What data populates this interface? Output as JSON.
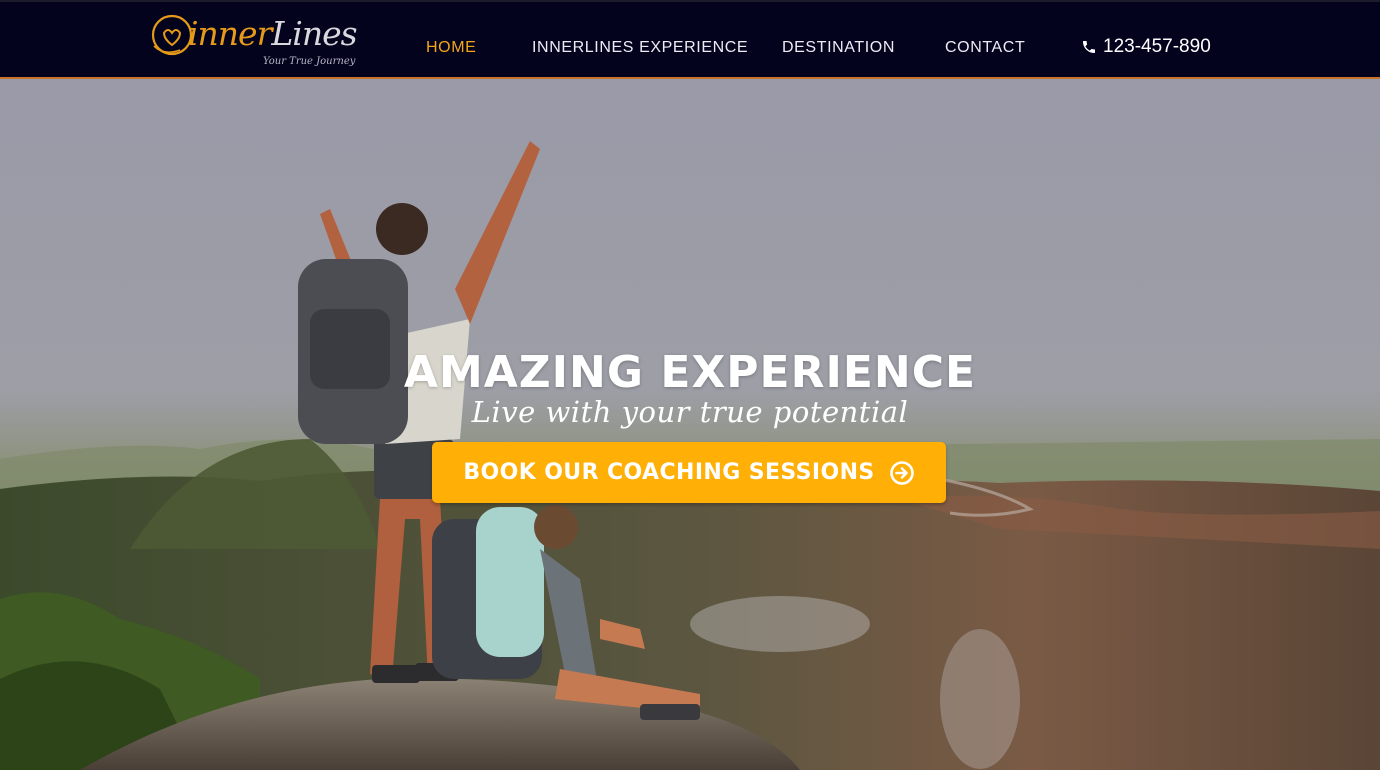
{
  "brand": {
    "name_part1": "inner",
    "name_part2": "Lines",
    "tagline": "Your True Journey",
    "logo_icon": "heart-swirl-logo",
    "primary_color": "#e59a1a"
  },
  "nav": {
    "items": [
      {
        "label": "HOME",
        "active": true
      },
      {
        "label": "INNERLINES EXPERIENCE",
        "active": false
      },
      {
        "label": "DESTINATION",
        "active": false
      },
      {
        "label": "CONTACT",
        "active": false
      }
    ],
    "phone": {
      "icon": "phone-icon",
      "number": "123-457-890"
    },
    "background_color": "#03031e",
    "active_color": "#f4a51c",
    "accent_border_color": "#c9732a"
  },
  "hero": {
    "title": "AMAZING EXPERIENCE",
    "subtitle": "Live with your true potential",
    "cta": {
      "label": "BOOK OUR COACHING SESSIONS",
      "icon": "arrow-circle-right-icon",
      "color": "#ffaf05"
    },
    "background_description_icon": "hikers-mountain-photo"
  }
}
